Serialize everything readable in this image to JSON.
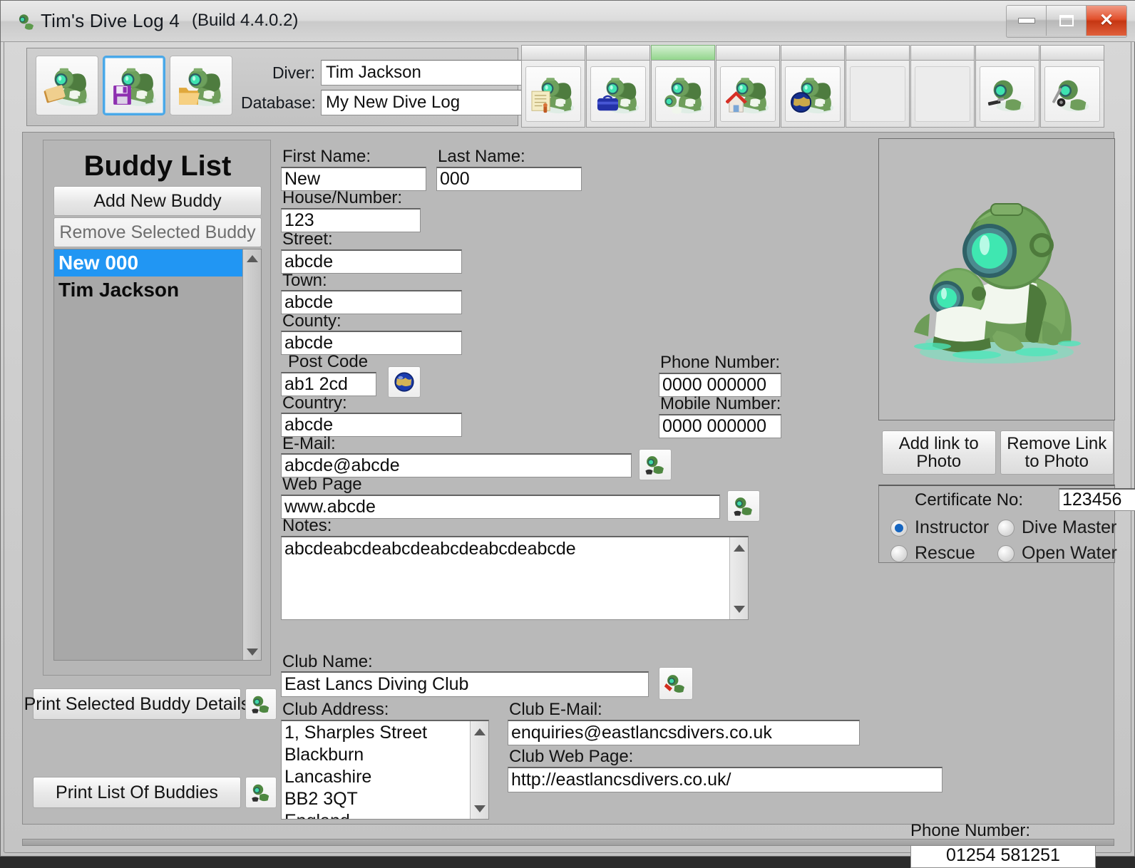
{
  "window": {
    "title": "Tim's Dive Log 4",
    "build": "(Build 4.4.0.2)",
    "minimize_label": "Minimize",
    "maximize_label": "Maximize",
    "close_label": "Close"
  },
  "toolbar": {
    "buttons": [
      {
        "name": "new-log-icon",
        "label": "New Log"
      },
      {
        "name": "save-log-icon",
        "label": "Save Log",
        "selected": true
      },
      {
        "name": "open-log-icon",
        "label": "Open Log"
      }
    ],
    "diver_label": "Diver:",
    "diver_value": "Tim Jackson",
    "database_label": "Database:",
    "database_value": "My New Dive Log"
  },
  "tabs": [
    {
      "name": "tab-dive-log",
      "icon": "diver-certificate-icon",
      "active": false,
      "empty": false
    },
    {
      "name": "tab-equipment",
      "icon": "diver-gearbag-icon",
      "active": false,
      "empty": false
    },
    {
      "name": "tab-buddies",
      "icon": "diver-buddy-icon",
      "active": true,
      "empty": false
    },
    {
      "name": "tab-dive-sites",
      "icon": "diver-house-icon",
      "active": false,
      "empty": false
    },
    {
      "name": "tab-world",
      "icon": "diver-globe-icon",
      "active": false,
      "empty": false
    },
    {
      "name": "tab-blank-1",
      "icon": "blank-icon",
      "active": false,
      "empty": true
    },
    {
      "name": "tab-blank-2",
      "icon": "blank-icon",
      "active": false,
      "empty": true
    },
    {
      "name": "tab-statistics",
      "icon": "diver-chart-icon",
      "active": false,
      "empty": false
    },
    {
      "name": "tab-tools",
      "icon": "diver-tools-icon",
      "active": false,
      "empty": false
    }
  ],
  "buddy_list": {
    "title": "Buddy List",
    "add_button": "Add New Buddy",
    "remove_button": "Remove Selected Buddy",
    "items": [
      {
        "label": "New 000",
        "selected": true
      },
      {
        "label": "Tim Jackson",
        "selected": false
      }
    ],
    "print_selected_button": "Print Selected Buddy Details",
    "print_list_button": "Print List Of Buddies"
  },
  "form": {
    "first_name_label": "First Name:",
    "first_name_value": "New",
    "last_name_label": "Last Name:",
    "last_name_value": "000",
    "house_label": "House/Number:",
    "house_value": "123",
    "street_label": "Street:",
    "street_value": "abcde",
    "town_label": "Town:",
    "town_value": "abcde",
    "county_label": "County:",
    "county_value": "abcde",
    "postcode_label": "Post Code",
    "postcode_value": "ab1 2cd",
    "country_label": "Country:",
    "country_value": "abcde",
    "email_label": "E-Mail:",
    "email_value": "abcde@abcde",
    "webpage_label": "Web Page",
    "webpage_value": "www.abcde",
    "notes_label": "Notes:",
    "notes_value": "abcdeabcdeabcdeabcdeabcdeabcde",
    "phone_label": "Phone Number:",
    "phone_value": "0000 000000",
    "mobile_label": "Mobile Number:",
    "mobile_value": "0000 000000"
  },
  "club": {
    "name_label": "Club Name:",
    "name_value": "East Lancs Diving Club",
    "address_label": "Club Address:",
    "address_lines": [
      "1, Sharples Street",
      "Blackburn",
      "Lancashire",
      "BB2 3QT",
      "England"
    ],
    "email_label": "Club E-Mail:",
    "email_value": "enquiries@eastlancsdivers.co.uk",
    "webpage_label": "Club Web Page:",
    "webpage_value": "http://eastlancsdivers.co.uk/",
    "phone_label": "Phone Number:",
    "phone_value": "01254 581251"
  },
  "photo": {
    "add_link_button": "Add link to\nPhoto",
    "add_link_line1": "Add link to",
    "add_link_line2": "Photo",
    "remove_link_line1": "Remove Link",
    "remove_link_line2": "to Photo",
    "image_alt": "diver-mascot-image"
  },
  "certificate": {
    "label": "Certificate No:",
    "value": "123456",
    "options": [
      {
        "label": "Instructor",
        "selected": true
      },
      {
        "label": "Dive Master",
        "selected": false
      },
      {
        "label": "Rescue",
        "selected": false
      },
      {
        "label": "Open Water",
        "selected": false
      }
    ]
  },
  "colors": {
    "selection_blue": "#2196f3",
    "active_tab_green": "#8fd488",
    "close_red": "#c53612",
    "window_gray": "#b9b9b9"
  }
}
